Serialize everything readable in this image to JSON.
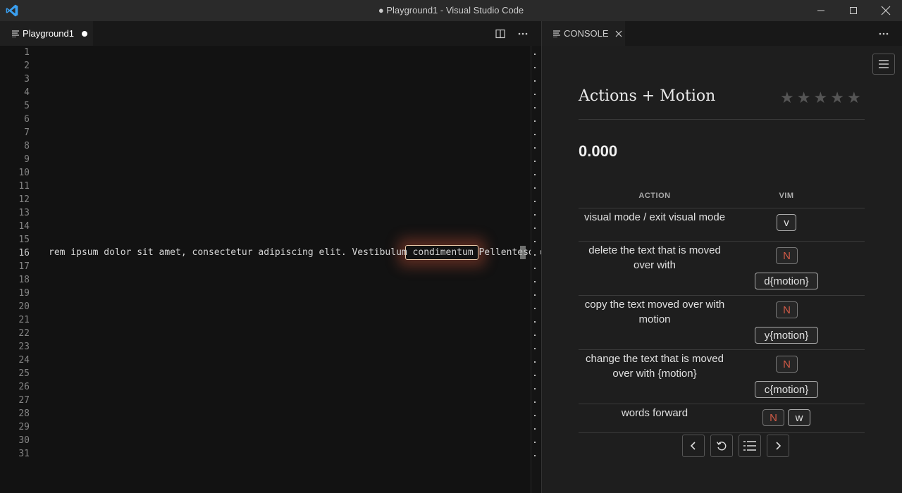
{
  "window": {
    "title": "● Playground1 - Visual Studio Code",
    "logo_icon": "vscode-logo-icon",
    "controls": [
      "minimize-icon",
      "maximize-icon",
      "close-icon"
    ]
  },
  "editor": {
    "tab_label": "Playground1",
    "tab_dirty": true,
    "actions": [
      "split-editor-icon",
      "more-actions-icon"
    ],
    "line_numbers": [
      "1",
      "2",
      "3",
      "4",
      "5",
      "6",
      "7",
      "8",
      "9",
      "10",
      "11",
      "12",
      "13",
      "14",
      "15",
      "16",
      "17",
      "18",
      "19",
      "20",
      "21",
      "22",
      "23",
      "24",
      "25",
      "26",
      "27",
      "28",
      "29",
      "30",
      "31"
    ],
    "active_line": "16",
    "code_line_text": "rem ipsum dolor sit amet, consectetur adipiscing elit. Vestibulum condimentum Pellentesque"
  },
  "console": {
    "tab_label": "CONSOLE",
    "more_icon": "more-actions-icon",
    "lesson_title": "Actions + Motion",
    "rating": {
      "value": 0,
      "max": 5
    },
    "score": "0.000",
    "table": {
      "headers": [
        "ACTION",
        "VIM"
      ],
      "rows": [
        {
          "description": "visual mode / exit visual mode",
          "keys": [
            "v"
          ]
        },
        {
          "description": "delete the text that is moved over with",
          "keys": [
            "N",
            "d{motion}"
          ]
        },
        {
          "description": "copy the text moved over with motion",
          "keys": [
            "N",
            "y{motion}"
          ]
        },
        {
          "description": "change the text that is moved over with {motion}",
          "keys": [
            "N",
            "c{motion}"
          ]
        },
        {
          "description": "words forward",
          "keys": [
            "N",
            "w"
          ]
        }
      ]
    },
    "nav": [
      "chevron-left-icon",
      "reset-icon",
      "list-icon",
      "chevron-right-icon"
    ]
  },
  "colors": {
    "accent_count_key": "#d05a46",
    "highlight_glow": "#dc5a3c",
    "vscode_blue": "#3aa0f2"
  }
}
